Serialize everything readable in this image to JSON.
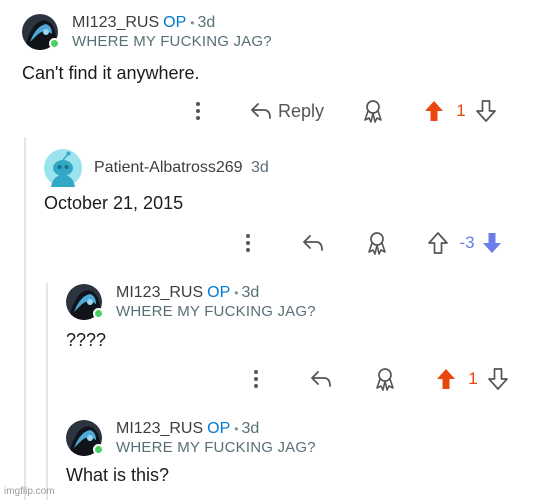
{
  "comments": [
    {
      "username": "MI123_RUS",
      "op_label": "OP",
      "separator": "•",
      "time": "3d",
      "flair": "WHERE MY FUCKING JAG?",
      "body": "Can't find it anywhere.",
      "reply_label": "Reply",
      "score": "1",
      "vote_state": "upvoted"
    },
    {
      "username": "Patient-Albatross269",
      "time": "3d",
      "body": "October 21, 2015",
      "score": "-3",
      "vote_state": "downvoted"
    },
    {
      "username": "MI123_RUS",
      "op_label": "OP",
      "separator": "•",
      "time": "3d",
      "flair": "WHERE MY FUCKING JAG?",
      "body": "????",
      "score": "1",
      "vote_state": "upvoted"
    },
    {
      "username": "MI123_RUS",
      "op_label": "OP",
      "separator": "•",
      "time": "3d",
      "flair": "WHERE MY FUCKING JAG?",
      "body": "What is this?"
    }
  ],
  "colors": {
    "upvote_active": "#e8470e",
    "downvote_active": "#6a7de8",
    "op": "#0079d3",
    "online": "#46d160"
  },
  "icons": [
    "more-icon",
    "reply-arrow-icon",
    "award-icon",
    "upvote-icon",
    "downvote-icon"
  ],
  "watermark": "imgflip.com"
}
